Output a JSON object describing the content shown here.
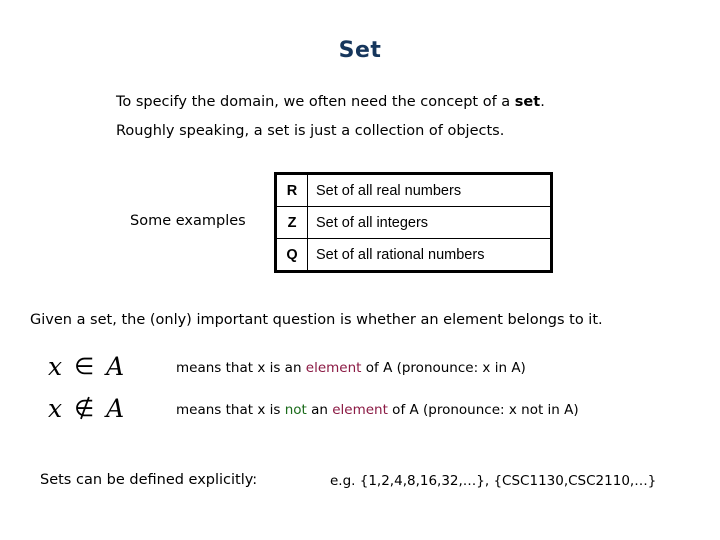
{
  "slide": {
    "title": "Set",
    "intro": {
      "line1_before": "To specify the domain, we often need the concept of a ",
      "line1_bold": "set",
      "line1_after": ".",
      "line2": "Roughly speaking, a set is just a collection of objects."
    },
    "examples": {
      "label": "Some examples",
      "rows": [
        {
          "symbol": "R",
          "description": "Set of all real numbers"
        },
        {
          "symbol": "Z",
          "description": "Set of all integers"
        },
        {
          "symbol": "Q",
          "description": "Set of all rational numbers"
        }
      ]
    },
    "statement": "Given a set, the (only) important question is whether an element belongs to it.",
    "membership": [
      {
        "expr_var": "x",
        "expr_op": "∈",
        "expr_set": "A",
        "text_before": "means that x is an ",
        "highlight_element": "element",
        "text_after": " of A  (pronounce: x in A)"
      },
      {
        "expr_var": "x",
        "expr_op": "∉",
        "expr_set": "A",
        "text_before": "means that x is ",
        "highlight_not": "not",
        "text_mid": " an ",
        "highlight_element": "element",
        "text_after": " of A  (pronounce: x not in A)"
      }
    ],
    "bottom": {
      "label": "Sets can be defined explicitly:",
      "examples": "e.g. {1,2,4,8,16,32,…}, {CSC1130,CSC2110,…}"
    },
    "colors": {
      "title": "#16365c",
      "element_highlight": "#8b1a44",
      "not_highlight": "#1a6b1a",
      "text": "#000000",
      "background": "#ffffff",
      "table_border": "#000000"
    }
  }
}
